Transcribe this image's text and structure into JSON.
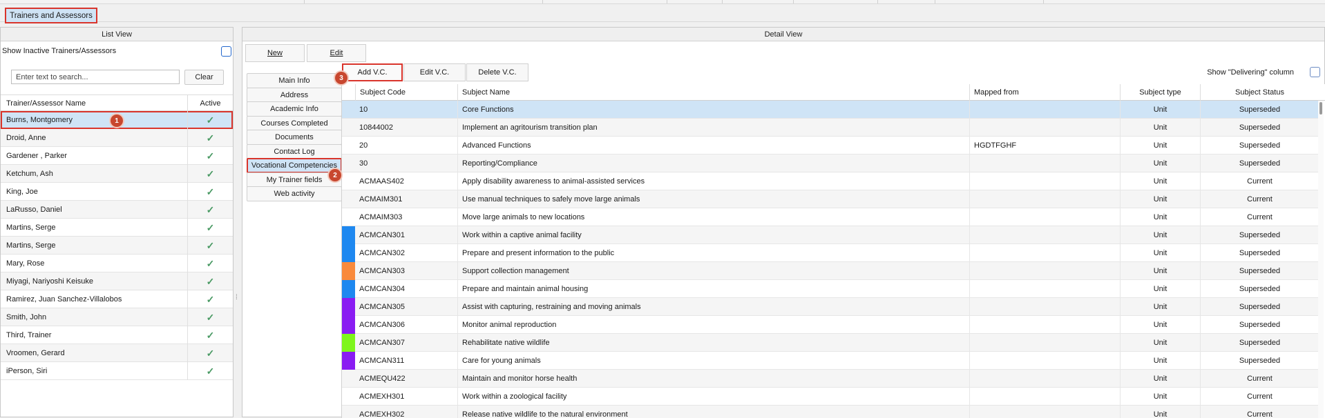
{
  "window": {
    "main_tab": "Trainers and Assessors"
  },
  "list_view": {
    "title": "List View",
    "show_inactive_label": "Show Inactive Trainers/Assessors",
    "search_placeholder": "Enter text to search...",
    "clear_label": "Clear",
    "columns": [
      "Trainer/Assessor Name",
      "Active"
    ],
    "rows": [
      {
        "name": "Burns, Montgomery",
        "active": true,
        "selected": true
      },
      {
        "name": "Droid, Anne",
        "active": true
      },
      {
        "name": "Gardener , Parker",
        "active": true
      },
      {
        "name": "Ketchum, Ash",
        "active": true
      },
      {
        "name": "King, Joe",
        "active": true
      },
      {
        "name": "LaRusso, Daniel",
        "active": true
      },
      {
        "name": "Martins, Serge",
        "active": true
      },
      {
        "name": "Martins, Serge",
        "active": true
      },
      {
        "name": "Mary, Rose",
        "active": true
      },
      {
        "name": "Miyagi, Nariyoshi Keisuke",
        "active": true
      },
      {
        "name": "Ramirez, Juan Sanchez-Villalobos",
        "active": true
      },
      {
        "name": "Smith, John",
        "active": true
      },
      {
        "name": "Third, Trainer",
        "active": true
      },
      {
        "name": "Vroomen, Gerard",
        "active": true
      },
      {
        "name": "iPerson, Siri",
        "active": true
      }
    ]
  },
  "detail_view": {
    "title": "Detail View",
    "new_label": "New",
    "edit_label": "Edit",
    "side_tabs": [
      "Main Info",
      "Address",
      "Academic Info",
      "Courses Completed",
      "Documents",
      "Contact Log",
      "Vocational Competencies",
      "My Trainer fields",
      "Web activity"
    ],
    "selected_side_tab": "Vocational Competencies",
    "add_vc_label": "Add V.C.",
    "edit_vc_label": "Edit V.C.",
    "delete_vc_label": "Delete V.C.",
    "show_delivering_label": "Show \"Delivering\" column",
    "columns": [
      "Subject Code",
      "Subject Name",
      "Mapped from",
      "Subject type",
      "Subject Status"
    ],
    "rows": [
      {
        "code": "10",
        "name": "Core Functions",
        "mapped": "",
        "type": "Unit",
        "status": "Superseded",
        "color": "",
        "selected": true
      },
      {
        "code": "10844002",
        "name": "Implement an agritourism transition plan",
        "mapped": "",
        "type": "Unit",
        "status": "Superseded",
        "color": ""
      },
      {
        "code": "20",
        "name": "Advanced Functions",
        "mapped": "HGDTFGHF",
        "type": "Unit",
        "status": "Superseded",
        "color": ""
      },
      {
        "code": "30",
        "name": "Reporting/Compliance",
        "mapped": "",
        "type": "Unit",
        "status": "Superseded",
        "color": ""
      },
      {
        "code": "ACMAAS402",
        "name": "Apply disability awareness to animal-assisted services",
        "mapped": "",
        "type": "Unit",
        "status": "Current",
        "color": ""
      },
      {
        "code": "ACMAIM301",
        "name": "Use manual techniques to safely move large animals",
        "mapped": "",
        "type": "Unit",
        "status": "Current",
        "color": ""
      },
      {
        "code": "ACMAIM303",
        "name": "Move large animals to new locations",
        "mapped": "",
        "type": "Unit",
        "status": "Current",
        "color": ""
      },
      {
        "code": "ACMCAN301",
        "name": "Work within a captive animal facility",
        "mapped": "",
        "type": "Unit",
        "status": "Superseded",
        "color": "#1e88f0"
      },
      {
        "code": "ACMCAN302",
        "name": "Prepare and present information to the public",
        "mapped": "",
        "type": "Unit",
        "status": "Superseded",
        "color": "#1e88f0"
      },
      {
        "code": "ACMCAN303",
        "name": "Support collection management",
        "mapped": "",
        "type": "Unit",
        "status": "Superseded",
        "color": "#f98a3c"
      },
      {
        "code": "ACMCAN304",
        "name": "Prepare and maintain animal housing",
        "mapped": "",
        "type": "Unit",
        "status": "Superseded",
        "color": "#1e88f0"
      },
      {
        "code": "ACMCAN305",
        "name": "Assist with capturing, restraining and moving animals",
        "mapped": "",
        "type": "Unit",
        "status": "Superseded",
        "color": "#8a1cf2"
      },
      {
        "code": "ACMCAN306",
        "name": "Monitor animal reproduction",
        "mapped": "",
        "type": "Unit",
        "status": "Superseded",
        "color": "#8a1cf2"
      },
      {
        "code": "ACMCAN307",
        "name": "Rehabilitate native wildlife",
        "mapped": "",
        "type": "Unit",
        "status": "Superseded",
        "color": "#7ef51c"
      },
      {
        "code": "ACMCAN311",
        "name": "Care for young animals",
        "mapped": "",
        "type": "Unit",
        "status": "Superseded",
        "color": "#8a1cf2"
      },
      {
        "code": "ACMEQU422",
        "name": "Maintain and monitor horse health",
        "mapped": "",
        "type": "Unit",
        "status": "Current",
        "color": ""
      },
      {
        "code": "ACMEXH301",
        "name": "Work within a zoological facility",
        "mapped": "",
        "type": "Unit",
        "status": "Current",
        "color": ""
      },
      {
        "code": "ACMEXH302",
        "name": "Release native wildlife to the natural environment",
        "mapped": "",
        "type": "Unit",
        "status": "Current",
        "color": ""
      }
    ]
  },
  "annotations": [
    {
      "number": "1"
    },
    {
      "number": "2"
    },
    {
      "number": "3"
    }
  ],
  "colors": {
    "selection": "#cfe4f6",
    "highlight_border": "#d9342b",
    "badge": "#c8472f",
    "check": "#4a9a64"
  }
}
